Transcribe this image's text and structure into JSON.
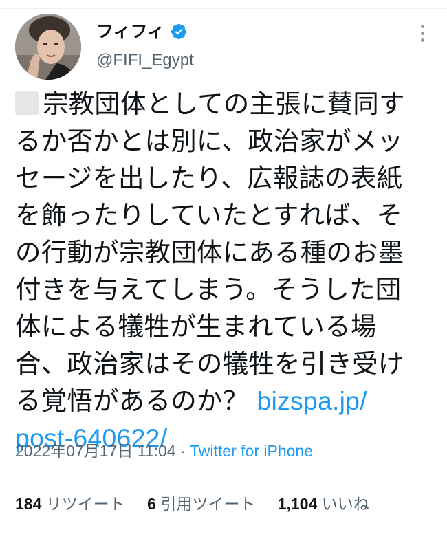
{
  "author": {
    "display_name": "フィフィ",
    "handle": "@FIFI_Egypt",
    "verified": true,
    "avatar_icon": "profile-photo"
  },
  "tweet": {
    "lines": [
      "宗教団体としての主張に賛同す",
      "るか否かとは別に、政治家がメッ",
      "セージを出したり、広報誌の表紙",
      "を飾ったりしていたとすれば、そ",
      "の行動が宗教団体にある種のお墨",
      "付きを与えてしまう。そうした団",
      "体による犠牲が生まれている場",
      "合、政治家はその犠牲を引き受け",
      "る覚悟があるのか？ "
    ],
    "link_part1": "bizspa.jp/",
    "link_part2": "post-640622/",
    "emoji_icon": "unsupported-emoji-box"
  },
  "meta": {
    "timestamp": "2022年07月17日 11:04",
    "separator": " · ",
    "source": "Twitter for iPhone"
  },
  "stats": {
    "retweets_count": "184",
    "retweets_label": "リツイート",
    "quotes_count": "6",
    "quotes_label": "引用ツイート",
    "likes_count": "1,104",
    "likes_label": "いいね"
  },
  "colors": {
    "accent": "#1d9bf0",
    "text": "#0f1419",
    "secondary": "#536471",
    "divider": "#eff3f4"
  }
}
